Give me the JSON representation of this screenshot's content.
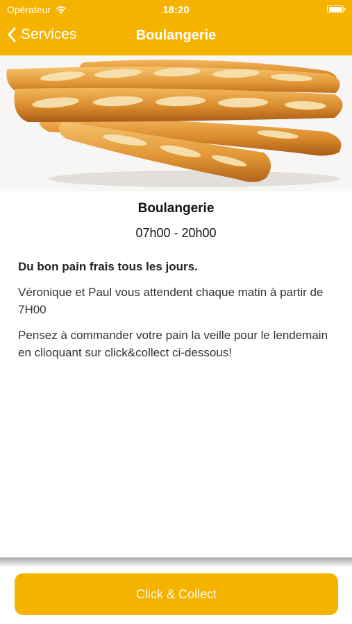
{
  "status_bar": {
    "carrier": "Opérateur",
    "time": "18:20"
  },
  "nav": {
    "back_label": "Services",
    "title": "Boulangerie"
  },
  "hero": {
    "image_subject": "baguettes"
  },
  "details": {
    "title": "Boulangerie",
    "hours": "07h00 - 20h00",
    "lead": "Du bon pain frais tous les jours.",
    "paragraphs": [
      "Véronique et Paul vous attendent chaque matin à partir de 7H00",
      "Pensez à commander votre pain la veille pour le lendemain en clioquant sur click&collect ci-dessous!"
    ]
  },
  "cta": {
    "label": "Click & Collect"
  },
  "colors": {
    "accent": "#f5b300",
    "text": "#1c1c1e"
  }
}
